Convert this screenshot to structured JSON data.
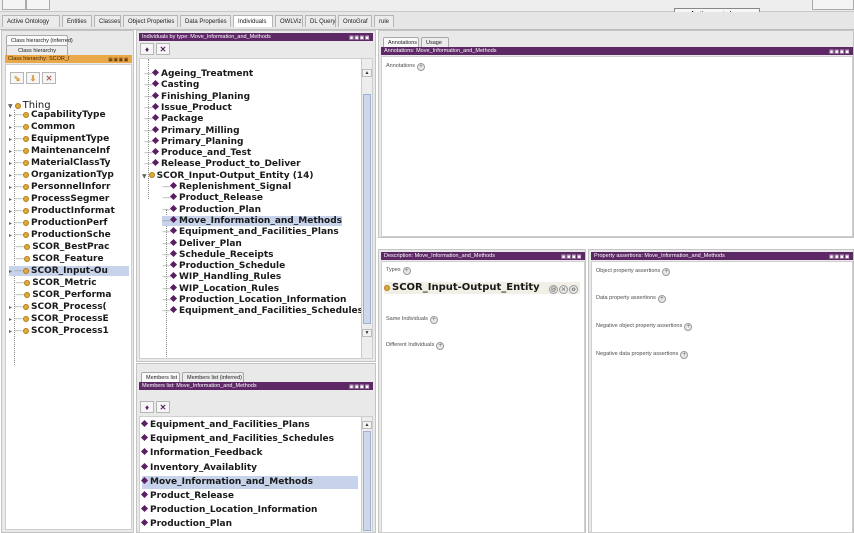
{
  "active_ontology_label": "Active ontology",
  "tabs": [
    "Active Ontology",
    "Entities",
    "Classes",
    "Object Properties",
    "Data Properties",
    "Individuals",
    "OWLViz",
    "DL Query",
    "OntoGraf",
    "rule"
  ],
  "left_panel": {
    "tab_inferred": "Class hierarchy (inferred)",
    "tab_hierarchy": "Class hierarchy",
    "header": "Class hierarchy: SCOR_I",
    "root": "Thing",
    "classes": [
      "CapabilityType",
      "Common",
      "EquipmentType",
      "MaintenanceInf",
      "MaterialClassTy",
      "OrganizationTyp",
      "PersonnelInforr",
      "ProcessSegmer",
      "ProductInformat",
      "ProductionPerf",
      "ProductionSche",
      "SCOR_BestPrac",
      "SCOR_Feature",
      "SCOR_Input-Ou",
      "SCOR_Metric",
      "SCOR_Performa",
      "SCOR_Process(",
      "SCOR_ProcessE",
      "SCOR_Process1"
    ]
  },
  "individuals_panel": {
    "header": "Individuals by type: Move_Information_and_Methods",
    "items": [
      "Ageing_Treatment",
      "Casting",
      "Finishing_Planing",
      "Issue_Product",
      "Package",
      "Primary_Milling",
      "Primary_Planing",
      "Produce_and_Test",
      "Release_Product_to_Deliver"
    ],
    "group": "SCOR_Input-Output_Entity (14)",
    "children": [
      "Replenishment_Signal",
      "Product_Release",
      "Production_Plan",
      "Move_Information_and_Methods",
      "Equipment_and_Facilities_Plans",
      "Deliver_Plan",
      "Schedule_Receipts",
      "Production_Schedule",
      "WIP_Handling_Rules",
      "WIP_Location_Rules",
      "Production_Location_Information",
      "Equipment_and_Facilities_Schedules"
    ]
  },
  "members_panel": {
    "tab_list": "Members list",
    "tab_inferred": "Members list (inferred)",
    "header": "Members list: Move_Information_and_Methods",
    "items": [
      "Equipment_and_Facilities_Plans",
      "Equipment_and_Facilities_Schedules",
      "Information_Feedback",
      "Inventory_Availablity",
      "Move_Information_and_Methods",
      "Product_Release",
      "Production_Location_Information",
      "Production_Plan"
    ]
  },
  "annotations_panel": {
    "tab_annotations": "Annotations",
    "tab_usage": "Usage",
    "header": "Annotations: Move_Information_and_Methods",
    "label": "Annotations"
  },
  "description_panel": {
    "header": "Description: Move_Information_and_Methods",
    "types_label": "Types",
    "type_value": "SCOR_Input-Output_Entity",
    "same_label": "Same Individuals",
    "different_label": "Different Individuals"
  },
  "property_panel": {
    "header": "Property assertions: Move_Information_and_Methods",
    "object_label": "Object property assertions",
    "data_label": "Data property assertions",
    "neg_object_label": "Negative object property assertions",
    "neg_data_label": "Negative data property assertions"
  },
  "colors": {
    "header_purple": "#5e2866",
    "header_orange": "#e9a84a",
    "selection": "#c7d3ea",
    "class_bullet": "#e0a93b",
    "individual_diamond": "#5a1f63"
  }
}
